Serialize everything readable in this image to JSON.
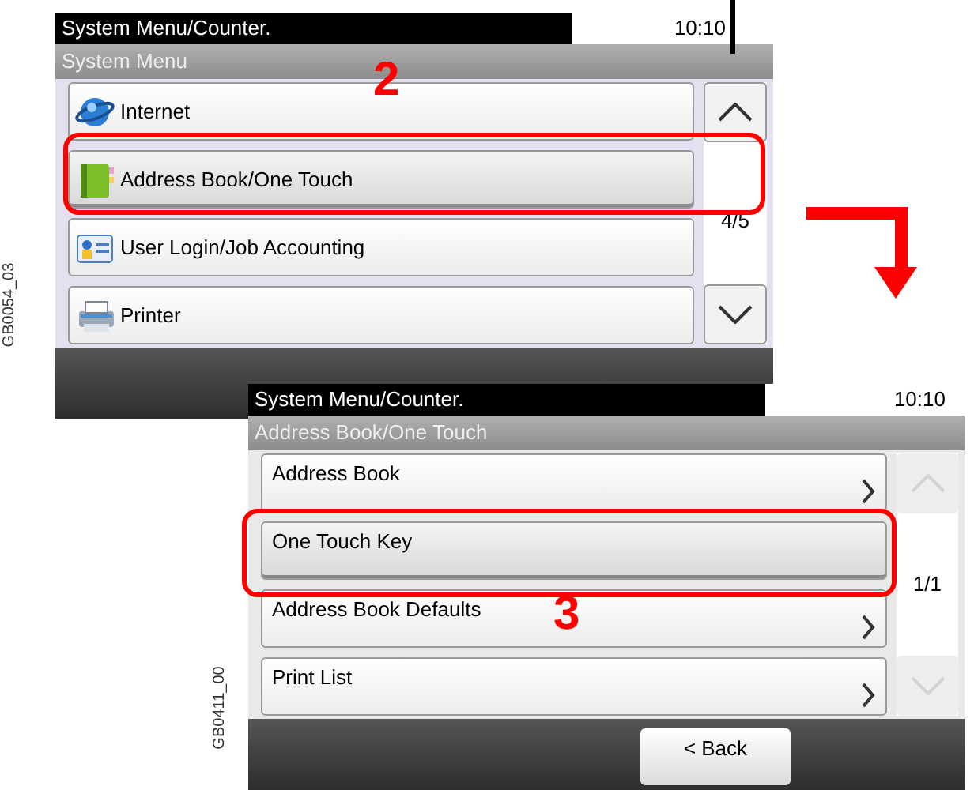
{
  "figure_labels": [
    "GB0054_03",
    "GB0411_00"
  ],
  "screens": [
    {
      "status_title": "System Menu/Counter.",
      "time": "10:10",
      "menu_title": "System Menu",
      "page": "4/5",
      "scroll_disabled": false,
      "items": [
        {
          "label": "Internet",
          "pressed": false
        },
        {
          "label": "Address Book/One Touch",
          "pressed": true
        },
        {
          "label": "User Login/Job Accounting",
          "pressed": false
        },
        {
          "label": "Printer",
          "pressed": false
        }
      ]
    },
    {
      "status_title": "System Menu/Counter.",
      "time": "10:10",
      "menu_title": "Address Book/One Touch",
      "page": "1/1",
      "scroll_disabled": true,
      "back_button": "< Back",
      "items": [
        {
          "label": "Address Book",
          "pressed": false
        },
        {
          "label": "One Touch Key",
          "pressed": true
        },
        {
          "label": "Address Book Defaults",
          "pressed": false
        },
        {
          "label": "Print List",
          "pressed": false
        }
      ]
    }
  ],
  "step_numbers": [
    "2",
    "3"
  ]
}
